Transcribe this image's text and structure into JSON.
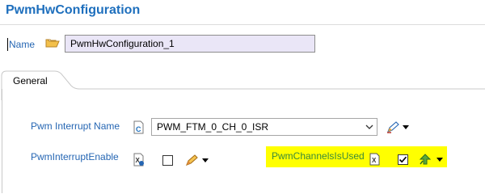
{
  "header": {
    "title": "PwmHwConfiguration"
  },
  "name_row": {
    "label": "Name",
    "value": "PwmHwConfiguration_1"
  },
  "tabs": [
    {
      "label": "General"
    }
  ],
  "fields": {
    "interrupt_name": {
      "label": "Pwm Interrupt Name",
      "value": "PWM_FTM_0_CH_0_ISR"
    },
    "interrupt_enable": {
      "label": "PwmInterruptEnable",
      "checked": false
    },
    "channels_used": {
      "label": "PwmChannelsIsUsed",
      "checked": true
    }
  },
  "colors": {
    "label_blue": "#2566b3",
    "title_blue": "#1e6fbd",
    "highlight": "#ffff00",
    "input_bg": "#eae6f7"
  }
}
